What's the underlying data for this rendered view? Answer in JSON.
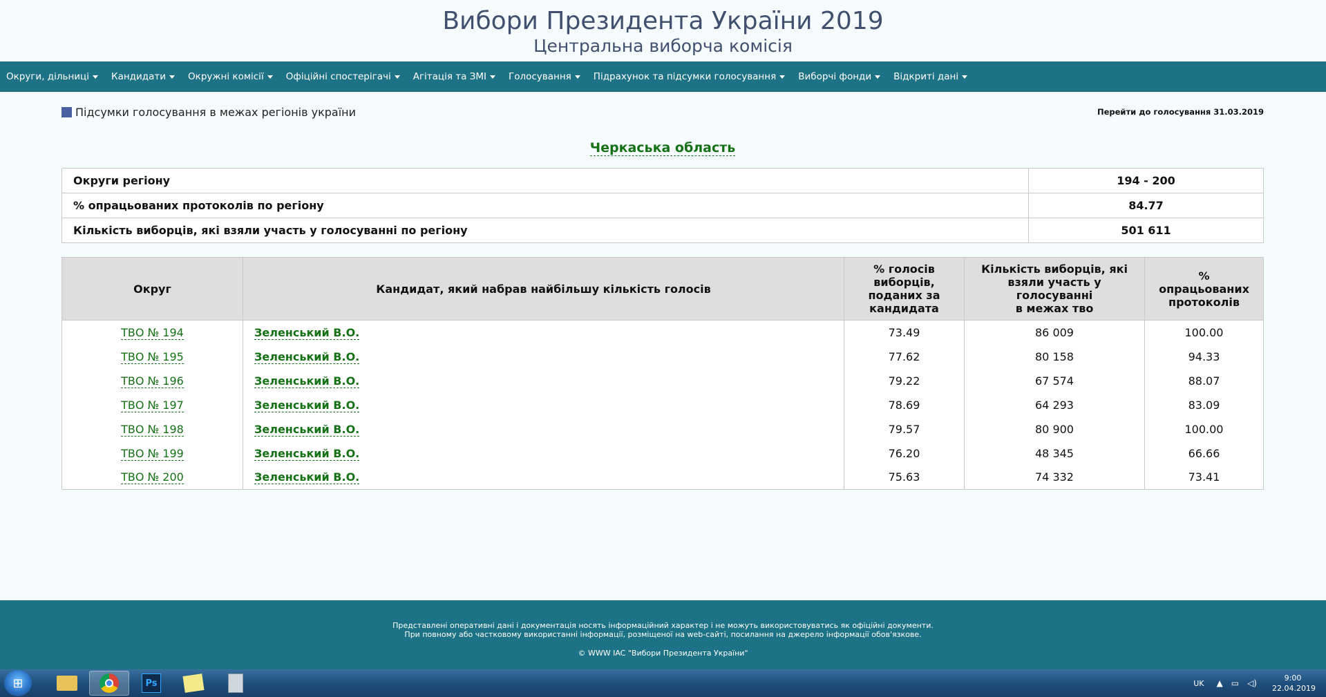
{
  "header": {
    "title": "Вибори Президента України 2019",
    "subtitle": "Центральна виборча комісія"
  },
  "nav": {
    "items": [
      "Округи, дільниці",
      "Кандидати",
      "Окружні комісії",
      "Офіційні спостерігачі",
      "Агітація та ЗМІ",
      "Голосування",
      "Підрахунок та підсумки голосування",
      "Виборчі фонди",
      "Відкриті дані"
    ]
  },
  "subhead": {
    "left": "Підсумки голосування в межах регіонів україни",
    "right": "Перейти до голосування 31.03.2019"
  },
  "region": {
    "title": "Черкаська область"
  },
  "summary": [
    {
      "label": "Округи регіону",
      "value": "194 - 200"
    },
    {
      "label": "% опрацьованих протоколів по регіону",
      "value": "84.77"
    },
    {
      "label": "Кількість виборців, які взяли участь у голосуванні по регіону",
      "value": "501 611"
    }
  ],
  "results": {
    "headers": {
      "district": "Округ",
      "candidate": "Кандидат, який набрав найбільшу кількість голосів",
      "percent_line1": "% голосів",
      "percent_line2": "виборців,",
      "percent_line3": "поданих за",
      "percent_line4": "кандидата",
      "voters_line1": "Кількість виборців, які",
      "voters_line2": "взяли участь у",
      "voters_line3": "голосуванні",
      "voters_line4": "в межах тво",
      "protocols_line1": "%",
      "protocols_line2": "опрацьованих",
      "protocols_line3": "протоколів"
    },
    "rows": [
      {
        "district": "ТВО № 194",
        "candidate": "Зеленський В.О.",
        "percent": "73.49",
        "voters": "86 009",
        "protocols": "100.00"
      },
      {
        "district": "ТВО № 195",
        "candidate": "Зеленський В.О.",
        "percent": "77.62",
        "voters": "80 158",
        "protocols": "94.33"
      },
      {
        "district": "ТВО № 196",
        "candidate": "Зеленський В.О.",
        "percent": "79.22",
        "voters": "67 574",
        "protocols": "88.07"
      },
      {
        "district": "ТВО № 197",
        "candidate": "Зеленський В.О.",
        "percent": "78.69",
        "voters": "64 293",
        "protocols": "83.09"
      },
      {
        "district": "ТВО № 198",
        "candidate": "Зеленський В.О.",
        "percent": "79.57",
        "voters": "80 900",
        "protocols": "100.00"
      },
      {
        "district": "ТВО № 199",
        "candidate": "Зеленський В.О.",
        "percent": "76.20",
        "voters": "48 345",
        "protocols": "66.66"
      },
      {
        "district": "ТВО № 200",
        "candidate": "Зеленський В.О.",
        "percent": "75.63",
        "voters": "74 332",
        "protocols": "73.41"
      }
    ]
  },
  "footer": {
    "line1": "Представлені оперативні дані і документація носять інформаційний характер і не можуть використовуватись як офіційні документи.",
    "line2": "При повному або частковому використанні інформації, розміщеної на web-сайті, посилання на джерело інформації обов'язкове.",
    "copyright": "© WWW IAC \"Вибори Президента України\""
  },
  "taskbar": {
    "apps": [
      {
        "name": "explorer",
        "icon": "folder-icon"
      },
      {
        "name": "chrome",
        "icon": "chrome-icon"
      },
      {
        "name": "photoshop",
        "icon": "photoshop-icon",
        "label": "Ps"
      },
      {
        "name": "sticky-notes",
        "icon": "sticky-notes-icon"
      },
      {
        "name": "calculator",
        "icon": "calculator-icon"
      }
    ],
    "language": "UK",
    "time": "9:00",
    "date": "22.04.2019"
  },
  "colors": {
    "nav_bg": "#1e7285",
    "title": "#40506e",
    "link_green": "#157115",
    "square": "#4b5fa3"
  }
}
